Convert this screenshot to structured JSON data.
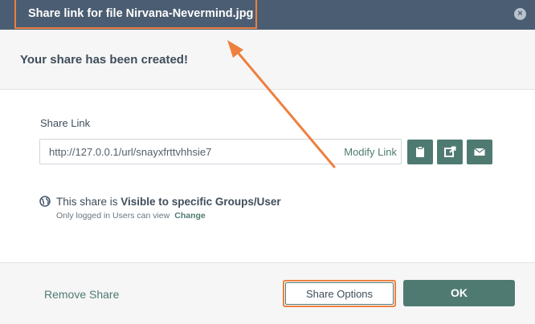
{
  "dialog": {
    "title": "Share link for file Nirvana-Nevermind.jpg",
    "close_icon": "×",
    "banner": "Your share has been created!"
  },
  "share_link": {
    "label": "Share Link",
    "url": "http://127.0.0.1/url/snayxfrttvhhsie7",
    "modify_label": "Modify Link",
    "buttons": [
      "clipboard-icon",
      "external-link-icon",
      "envelope-icon"
    ]
  },
  "visibility": {
    "prefix": "This share is ",
    "value": "Visible to specific Groups/User",
    "sub_text": "Only logged in Users can view",
    "change_label": "Change"
  },
  "footer": {
    "remove_label": "Remove Share",
    "options_label": "Share Options",
    "ok_label": "OK"
  },
  "colors": {
    "titlebar": "#4a5d72",
    "accent": "#4f7a72",
    "annotation": "#ee7f3e"
  }
}
